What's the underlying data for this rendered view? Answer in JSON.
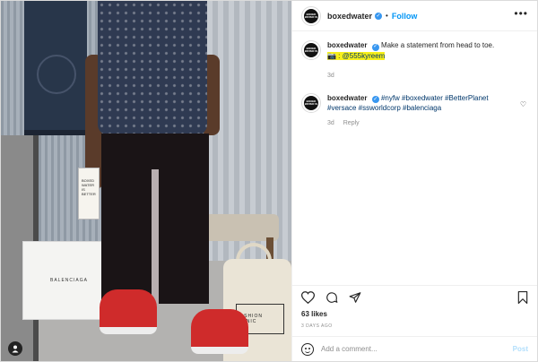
{
  "header": {
    "username": "boxedwater",
    "separator": "•",
    "follow_label": "Follow",
    "more_label": "•••"
  },
  "avatar_text": "BOXED WATER IS",
  "photo": {
    "box_label": "BALENCIAGA",
    "bag_label": "FASHION CLINIC",
    "carton_text": "BOXED WATER IS BETTER"
  },
  "comments": [
    {
      "username": "boxedwater",
      "text": "Make a statement from head to toe.",
      "credit_prefix": "📷 : ",
      "credit_handle": "@555kyreem",
      "time": "3d",
      "reply_label": ""
    },
    {
      "username": "boxedwater",
      "hashtags": "#nyfw #boxedwater #BetterPlanet #versace #ssworldcorp #balenciaga",
      "time": "3d",
      "reply_label": "Reply"
    }
  ],
  "likes": "63 likes",
  "date": "3 DAYS AGO",
  "add_comment": {
    "placeholder": "Add a comment...",
    "post_label": "Post"
  },
  "colors": {
    "accent": "#0095f6",
    "verified": "#3897f0",
    "highlight": "#f7f01a",
    "post_disabled": "#b2dffc"
  }
}
